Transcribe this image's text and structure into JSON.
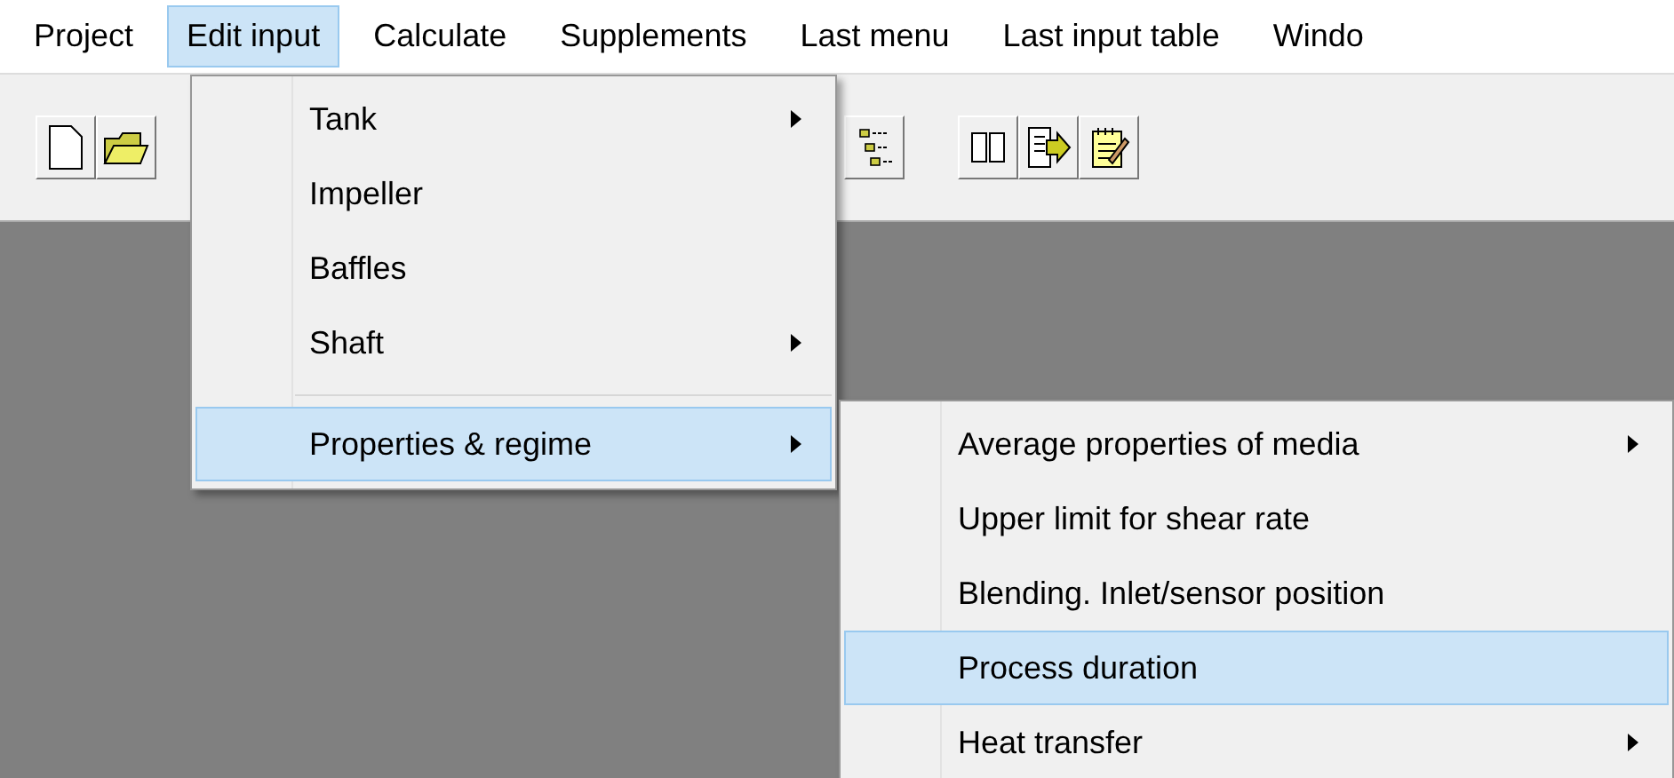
{
  "menubar": [
    {
      "label": "Project",
      "selected": false
    },
    {
      "label": "Edit input",
      "selected": true
    },
    {
      "label": "Calculate",
      "selected": false
    },
    {
      "label": "Supplements",
      "selected": false
    },
    {
      "label": "Last menu",
      "selected": false
    },
    {
      "label": "Last input table",
      "selected": false
    },
    {
      "label": "Windo",
      "selected": false
    }
  ],
  "edit_menu": [
    {
      "kind": "item",
      "label": "Tank",
      "submenu": true,
      "selected": false
    },
    {
      "kind": "item",
      "label": "Impeller",
      "submenu": false,
      "selected": false
    },
    {
      "kind": "item",
      "label": "Baffles",
      "submenu": false,
      "selected": false
    },
    {
      "kind": "item",
      "label": "Shaft",
      "submenu": true,
      "selected": false
    },
    {
      "kind": "separator"
    },
    {
      "kind": "item",
      "label": "Properties & regime",
      "submenu": true,
      "selected": true
    }
  ],
  "properties_submenu": [
    {
      "kind": "item",
      "label": "Average properties of media",
      "submenu": true,
      "selected": false
    },
    {
      "kind": "item",
      "label": "Upper limit for shear rate",
      "submenu": false,
      "selected": false
    },
    {
      "kind": "item",
      "label": "Blending. Inlet/sensor position",
      "submenu": false,
      "selected": false
    },
    {
      "kind": "item",
      "label": "Process duration",
      "submenu": false,
      "selected": true
    },
    {
      "kind": "item",
      "label": "Heat transfer",
      "submenu": true,
      "selected": false
    }
  ]
}
